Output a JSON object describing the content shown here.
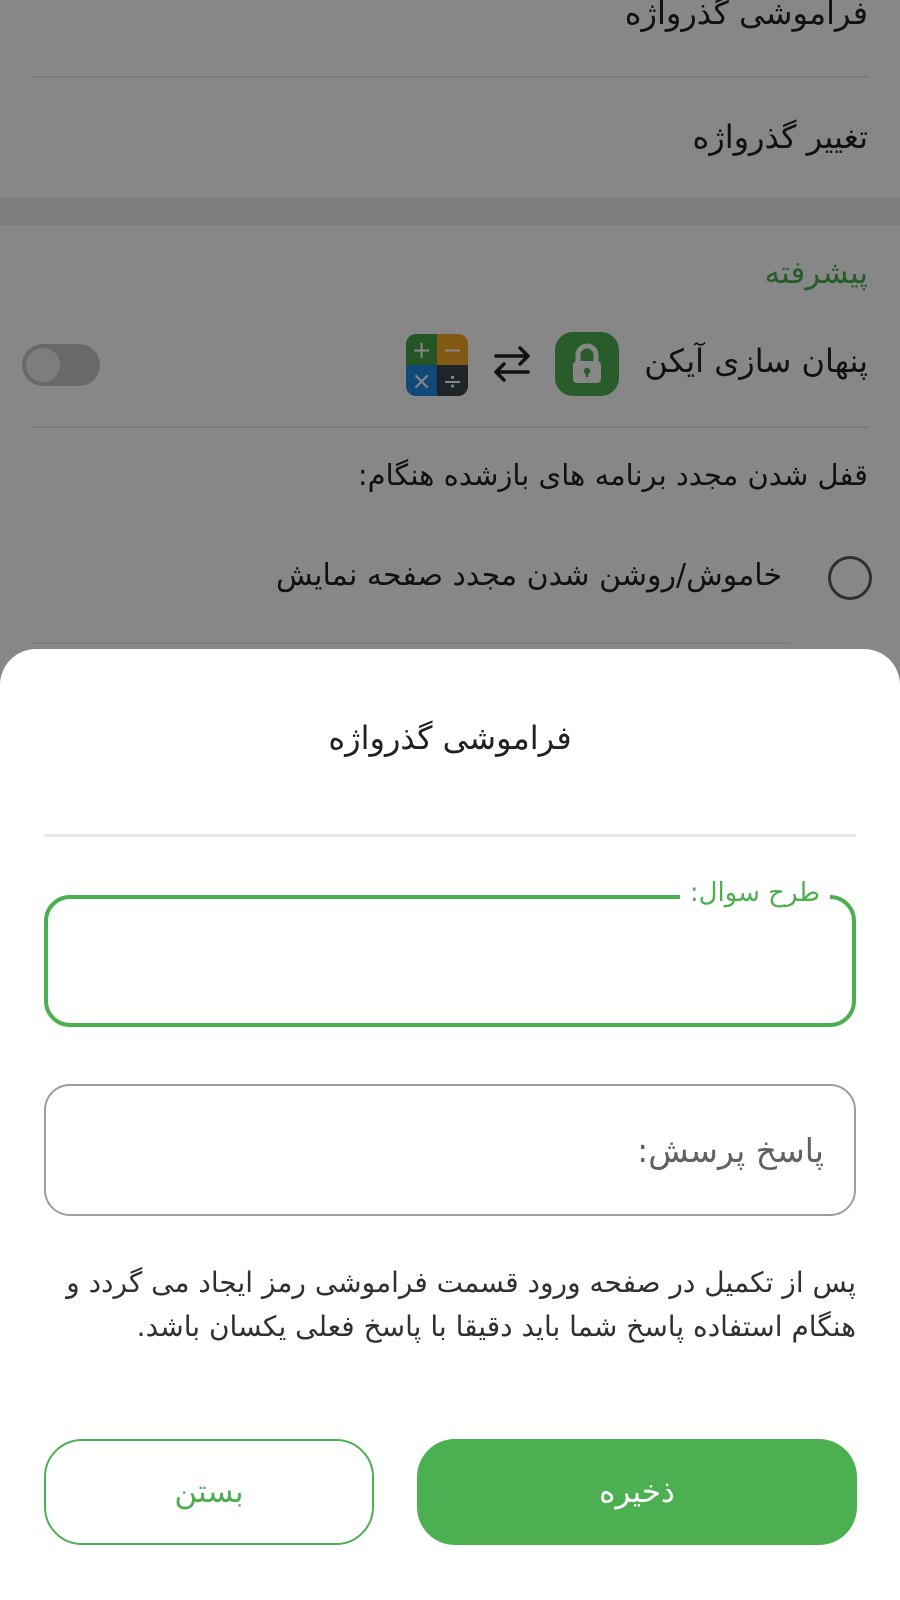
{
  "settings": {
    "rows": {
      "forgot_password": "فراموشی گذرواژه",
      "change_password": "تغییر گذرواژه"
    },
    "advanced": {
      "section_title": "پیشرفته",
      "hide_icon_label": "پنهان سازی آیکن",
      "hide_icon_enabled": false,
      "calculator_symbols": [
        "+",
        "−",
        "×",
        "÷"
      ],
      "relock_label": "قفل شدن مجدد برنامه های بازشده هنگام:",
      "relock_option_screen": "خاموش/روشن شدن مجدد صفحه نمایش",
      "relock_option_selected": false
    }
  },
  "dialog": {
    "title": "فراموشی گذرواژه",
    "question_field": {
      "label": "طرح سوال:",
      "value": ""
    },
    "answer_field": {
      "placeholder": "پاسخ پرسش:",
      "value": ""
    },
    "hint": "پس از تکمیل در صفحه ورود قسمت فراموشی رمز ایجاد می گردد و هنگام استفاده پاسخ شما باید دقیقا با پاسخ فعلی یکسان باشد.",
    "buttons": {
      "save": "ذخیره",
      "close": "بستن"
    }
  },
  "colors": {
    "accent": "#4caf50",
    "text": "#212121",
    "calc_plus": "#43a047",
    "calc_minus": "#f9a825",
    "calc_times": "#1e88e5",
    "calc_divide": "#37474f"
  }
}
